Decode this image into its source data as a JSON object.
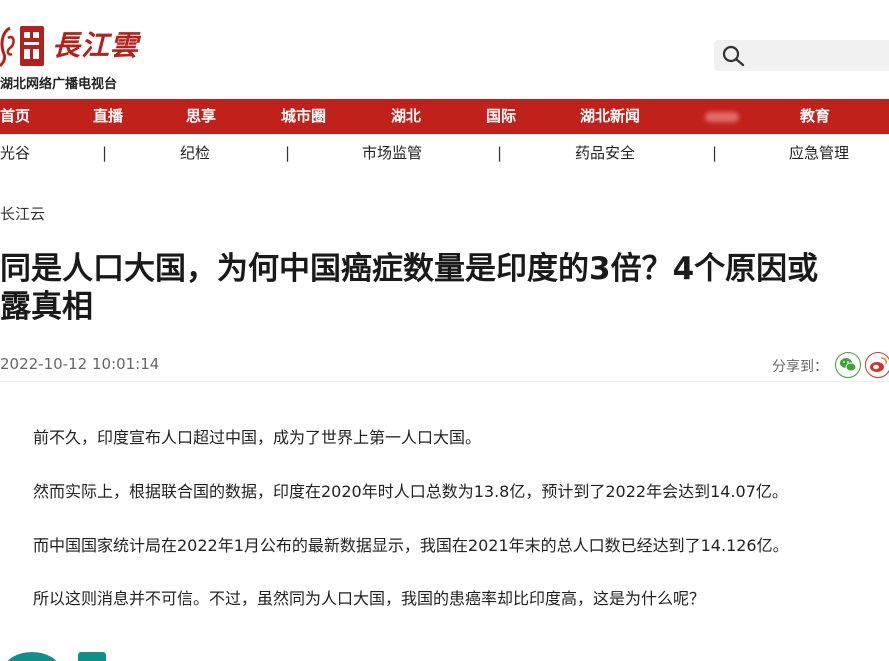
{
  "header": {
    "logo_script": "長江雲",
    "logo_sub": "湖北网络广播电视台",
    "search": {
      "placeholder": ""
    }
  },
  "nav": {
    "primary": [
      "首页",
      "直播",
      "思享",
      "城市圈",
      "湖北",
      "国际",
      "湖北新闻",
      "",
      "教育"
    ],
    "secondary": [
      "光谷",
      "纪检",
      "市场监管",
      "药品安全",
      "应急管理"
    ],
    "separator": "|"
  },
  "article": {
    "source": "长江云",
    "title_line1": "同是人口大国，为何中国癌症数量是印度的3倍？4个原因或",
    "title_line2": "露真相",
    "time": "2022-10-12 10:01:14",
    "share_label": "分享到：",
    "paragraphs": [
      "前不久，印度宣布人口超过中国，成为了世界上第一人口大国。",
      "然而实际上，根据联合国的数据，印度在2020年时人口总数为13.8亿，预计到了2022年会达到14.07亿。",
      "而中国国家统计局在2022年1月公布的最新数据显示，我国在2021年末的总人口数已经达到了14.126亿。",
      "所以这则消息并不可信。不过，虽然同为人口大国，我国的患癌率却比印度高，这是为什么呢？"
    ]
  },
  "colors": {
    "brand_red": "#c1211b",
    "wechat_green": "#3aa52f",
    "weibo_red": "#d1332b",
    "teal_deco": "#0f8f8a"
  },
  "icons": [
    "logo-emblem-icon",
    "search-icon",
    "wechat-icon",
    "weibo-icon"
  ]
}
